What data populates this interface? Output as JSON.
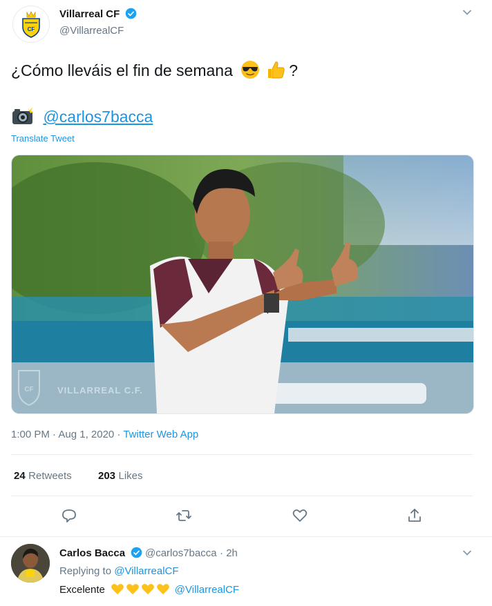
{
  "author": {
    "name": "Villarreal CF",
    "handle": "@VillarrealCF"
  },
  "tweet": {
    "text": "¿Cómo lleváis el fin de semana",
    "text_suffix": "?",
    "camera_mention": "@carlos7bacca",
    "translate_label": "Translate Tweet",
    "media_watermark": "VILLARREAL C.F.",
    "timestamp": "1:00 PM · Aug 1, 2020 · ",
    "source": "Twitter Web App"
  },
  "stats": {
    "retweets_count": "24",
    "retweets_label": "Retweets",
    "likes_count": "203",
    "likes_label": "Likes"
  },
  "actions": {
    "reply_icon": "reply-icon",
    "retweet_icon": "retweet-icon",
    "like_icon": "heart-icon",
    "share_icon": "share-icon"
  },
  "reply": {
    "name": "Carlos Bacca",
    "handle": "@carlos7bacca",
    "time": "· 2h",
    "replying_to_label": "Replying to",
    "replying_to_handle": "@VillarrealCF",
    "text": "Excelente",
    "mention": "@VillarrealCF"
  },
  "colors": {
    "link_blue": "#1b95e0",
    "text_primary": "#14171a",
    "text_secondary": "#657786",
    "divider": "#e6ecf0",
    "brand_yellow": "#fcd20a"
  }
}
